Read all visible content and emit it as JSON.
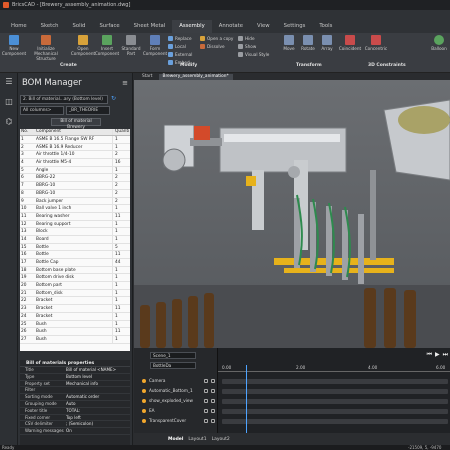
{
  "window": {
    "title": "BricsCAD - [Brewery_assembly_animation.dwg]"
  },
  "ribbon_tabs": [
    "Home",
    "Sketch",
    "Solid",
    "Surface",
    "Sheet Metal",
    "Assembly",
    "Annotate",
    "View",
    "Settings",
    "Tools"
  ],
  "ribbon_active_tab": "Assembly",
  "ribbon": {
    "buttons": {
      "new_component": "New Component",
      "mechanical_structure": "Initialize Mechanical Structure",
      "open": "Open Component",
      "insert": "Insert Component",
      "standard_part": "Standard Part",
      "form_component": "Form Component",
      "replace": "Replace",
      "local": "Local",
      "external": "External",
      "embed": "Embed",
      "open_copy": "Open a copy",
      "dissolve": "Dissolve",
      "hide": "Hide",
      "show": "Show",
      "visual_style": "Visual Style",
      "move": "Move",
      "rotate": "Rotate",
      "array": "Array",
      "coincident": "Coincident",
      "concentric": "Concentric",
      "balloon": "Balloon"
    },
    "groups": {
      "create": "Create",
      "modify": "Modify",
      "transform": "Transform",
      "constraints": "3D Constraints"
    }
  },
  "bom_manager": {
    "title": "BOM Manager",
    "bom_select": "2. Bill of material...ary (Bottom level)",
    "columns_select": "All columns>",
    "filter_select": "_BR_THEORIE",
    "button_label": "Bill of material Brewery",
    "table_headers": [
      "No.",
      "Component",
      "Quanti"
    ],
    "rows": [
      [
        "1",
        "ASME B 16.5 Flange SW RF",
        "1"
      ],
      [
        "2",
        "ASME B 16.9 Reducer",
        "1"
      ],
      [
        "3",
        "Air throttle 1/4-10",
        "2"
      ],
      [
        "4",
        "Air throttle M5-4",
        "16"
      ],
      [
        "5",
        "Angle",
        "1"
      ],
      [
        "6",
        "BBRG-22",
        "2"
      ],
      [
        "7",
        "BBRG-10",
        "2"
      ],
      [
        "8",
        "BBRG-10",
        "2"
      ],
      [
        "9",
        "Back jumper",
        "2"
      ],
      [
        "10",
        "Ball valve 1 inch",
        "1"
      ],
      [
        "11",
        "Bearing washer",
        "11"
      ],
      [
        "12",
        "Bearing support",
        "1"
      ],
      [
        "13",
        "Block",
        "1"
      ],
      [
        "14",
        "Board",
        "1"
      ],
      [
        "15",
        "Bottle",
        "5"
      ],
      [
        "16",
        "Bottle",
        "11"
      ],
      [
        "17",
        "Bottle Cap",
        "44"
      ],
      [
        "18",
        "Bottom base plate",
        "1"
      ],
      [
        "19",
        "Bottom drive disk",
        "1"
      ],
      [
        "20",
        "Bottom part",
        "1"
      ],
      [
        "21",
        "Bottom_disk",
        "1"
      ],
      [
        "22",
        "Bracket",
        "1"
      ],
      [
        "23",
        "Bracket",
        "11"
      ],
      [
        "24",
        "Bracket",
        "1"
      ],
      [
        "25",
        "Bush",
        "1"
      ],
      [
        "26",
        "Bush",
        "11"
      ],
      [
        "27",
        "Bush",
        "1"
      ]
    ]
  },
  "properties": {
    "title": "Bill of materials properties",
    "items": [
      [
        "Title",
        "Bill of material <NAME>"
      ],
      [
        "Type",
        "Bottom level"
      ],
      [
        "Property set",
        "Mechanical info"
      ],
      [
        "Filter",
        ""
      ],
      [
        "Sorting mode",
        "Automatic order"
      ],
      [
        "Grouping mode",
        "Auto"
      ],
      [
        "Footer title",
        "TOTAL:"
      ],
      [
        "Fixed corner",
        "Top left"
      ],
      [
        "CSV delimiter",
        "; (Semicolon)"
      ],
      [
        "Warning messages",
        "On"
      ]
    ]
  },
  "doc_tabs": [
    "Start",
    "Brewery_assembly_animation*"
  ],
  "doc_active": "Brewery_assembly_animation*",
  "animation": {
    "scene_select": "Scene_1",
    "sub_select": "BottleDa",
    "items": [
      "Camera",
      "Automatic_Bottom_1",
      "show_exploded_view",
      "EA",
      "TransparentCover"
    ],
    "ticks": [
      "0.00",
      "2.00",
      "4.00",
      "6.00"
    ]
  },
  "layout_tabs": [
    "Model",
    "Layout1",
    "Layout2"
  ],
  "layout_active": "Model",
  "status": {
    "left": "Ready",
    "coords": "-21509, 5, -9470"
  },
  "colors": {
    "accent": "#e25a2b",
    "yellow_part": "#e7b21b",
    "timeline_cursor": "#4da3ff"
  }
}
